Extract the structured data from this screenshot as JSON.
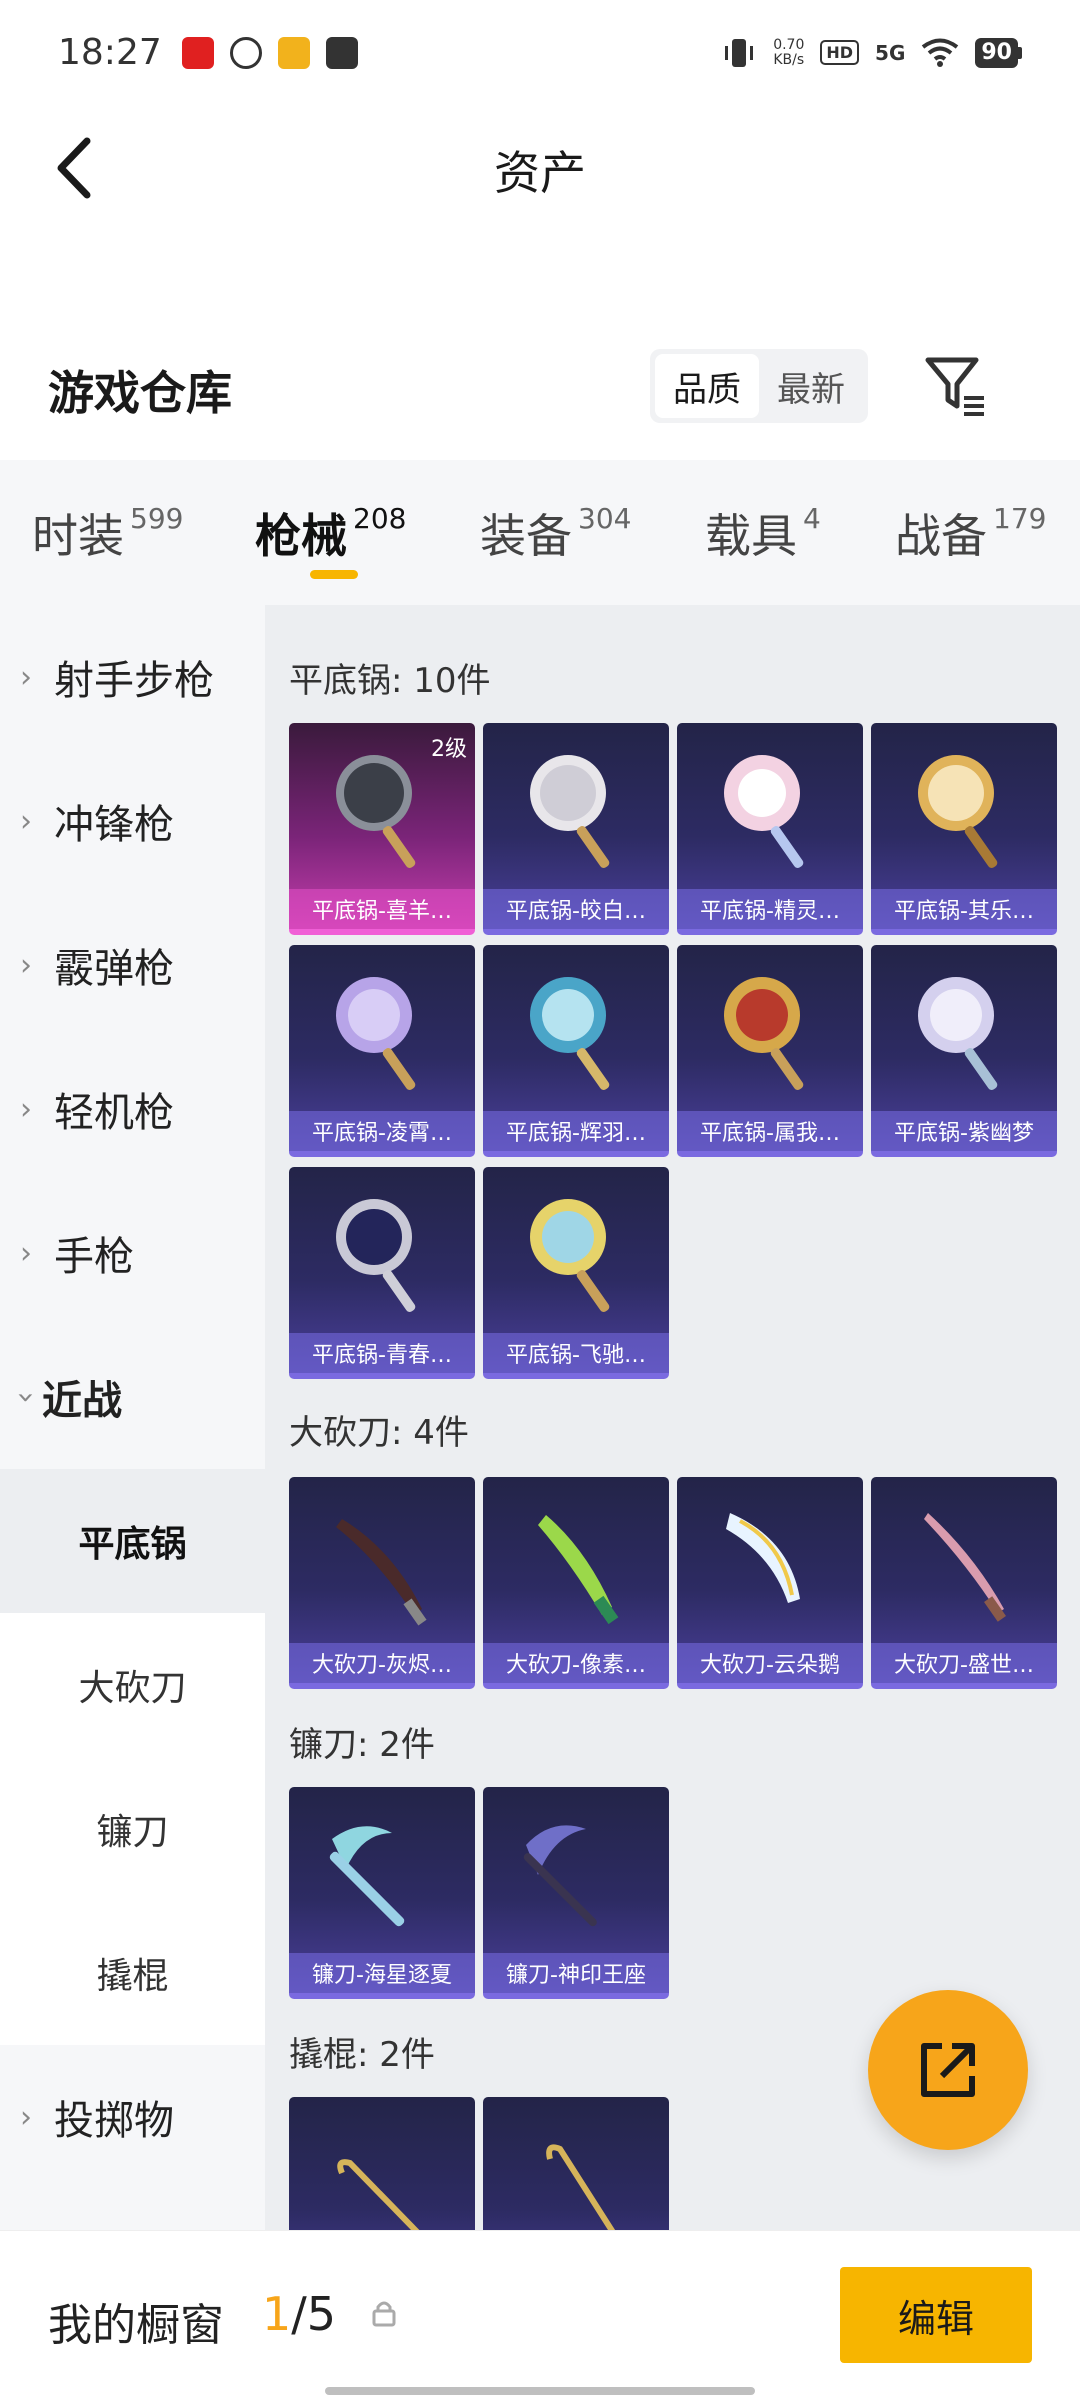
{
  "status_bar": {
    "time": "18:27",
    "net_speed_value": "0.70",
    "net_speed_unit": "KB/s",
    "hd": "HD",
    "signal": "5G",
    "battery": "90"
  },
  "header": {
    "title": "资产"
  },
  "warehouse": {
    "title": "游戏仓库",
    "sort_options": [
      "品质",
      "最新"
    ],
    "sort_selected": "品质"
  },
  "category_tabs": [
    {
      "label": "时装",
      "count": "599"
    },
    {
      "label": "枪械",
      "count": "208"
    },
    {
      "label": "装备",
      "count": "304"
    },
    {
      "label": "载具",
      "count": "4"
    },
    {
      "label": "战备",
      "count": "179"
    }
  ],
  "active_tab": "枪械",
  "sidebar": {
    "groups": [
      "射手步枪",
      "冲锋枪",
      "霰弹枪",
      "轻机枪",
      "手枪",
      "近战",
      "投掷物"
    ],
    "open_group": "近战",
    "subitems": [
      "平底锅",
      "大砍刀",
      "镰刀",
      "撬棍"
    ],
    "active_subitem": "平底锅"
  },
  "sections": [
    {
      "title": "平底锅: 10件",
      "items": [
        {
          "name": "平底锅-喜羊…",
          "level": "2级",
          "rarity": "pink"
        },
        {
          "name": "平底锅-皎白…"
        },
        {
          "name": "平底锅-精灵…"
        },
        {
          "name": "平底锅-其乐…"
        },
        {
          "name": "平底锅-凌霄…"
        },
        {
          "name": "平底锅-辉羽…"
        },
        {
          "name": "平底锅-属我…"
        },
        {
          "name": "平底锅-紫幽梦"
        },
        {
          "name": "平底锅-青春…"
        },
        {
          "name": "平底锅-飞驰…"
        }
      ]
    },
    {
      "title": "大砍刀: 4件",
      "items": [
        {
          "name": "大砍刀-灰烬…"
        },
        {
          "name": "大砍刀-像素…"
        },
        {
          "name": "大砍刀-云朵鹅"
        },
        {
          "name": "大砍刀-盛世…"
        }
      ]
    },
    {
      "title": "镰刀: 2件",
      "items": [
        {
          "name": "镰刀-海星逐夏"
        },
        {
          "name": "镰刀-神印王座"
        }
      ]
    },
    {
      "title": "撬棍: 2件",
      "items": [
        {
          "name": ""
        },
        {
          "name": ""
        }
      ]
    }
  ],
  "bottom_bar": {
    "label": "我的橱窗",
    "current": "1",
    "total": "/5",
    "edit_label": "编辑"
  },
  "colors": {
    "accent": "#f7b500",
    "fab": "#f7a51a",
    "pink_rarity": "#c43dac",
    "purple_rarity": "#4a3f9a"
  },
  "icons": [
    "back-arrow-icon",
    "filter-icon",
    "share-icon",
    "lock-icon",
    "chevron-right-icon",
    "chevron-down-icon"
  ]
}
